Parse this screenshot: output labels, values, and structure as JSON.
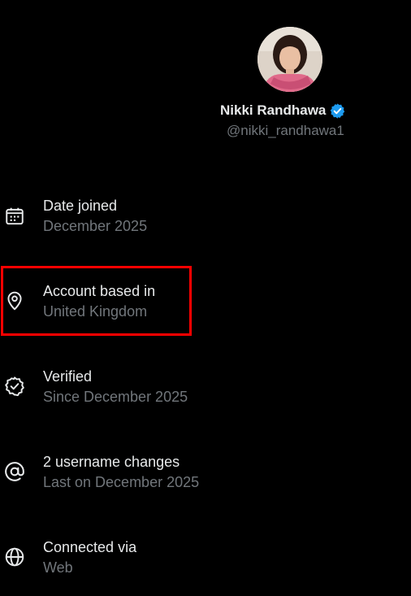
{
  "profile": {
    "display_name": "Nikki Randhawa",
    "handle": "@nikki_randhawa1",
    "verified": true
  },
  "info_items": [
    {
      "icon": "calendar-icon",
      "label": "Date joined",
      "value": "December 2025"
    },
    {
      "icon": "location-pin-icon",
      "label": "Account based in",
      "value": "United Kingdom"
    },
    {
      "icon": "verified-check-icon",
      "label": "Verified",
      "value": "Since December 2025"
    },
    {
      "icon": "at-sign-icon",
      "label": "2 username changes",
      "value": "Last on December 2025"
    },
    {
      "icon": "globe-icon",
      "label": "Connected via",
      "value": "Web"
    }
  ],
  "colors": {
    "background": "#000000",
    "primary_text": "#e7e9ea",
    "secondary_text": "#71767b",
    "verified_blue": "#1d9bf0",
    "highlight": "#ff0000"
  }
}
